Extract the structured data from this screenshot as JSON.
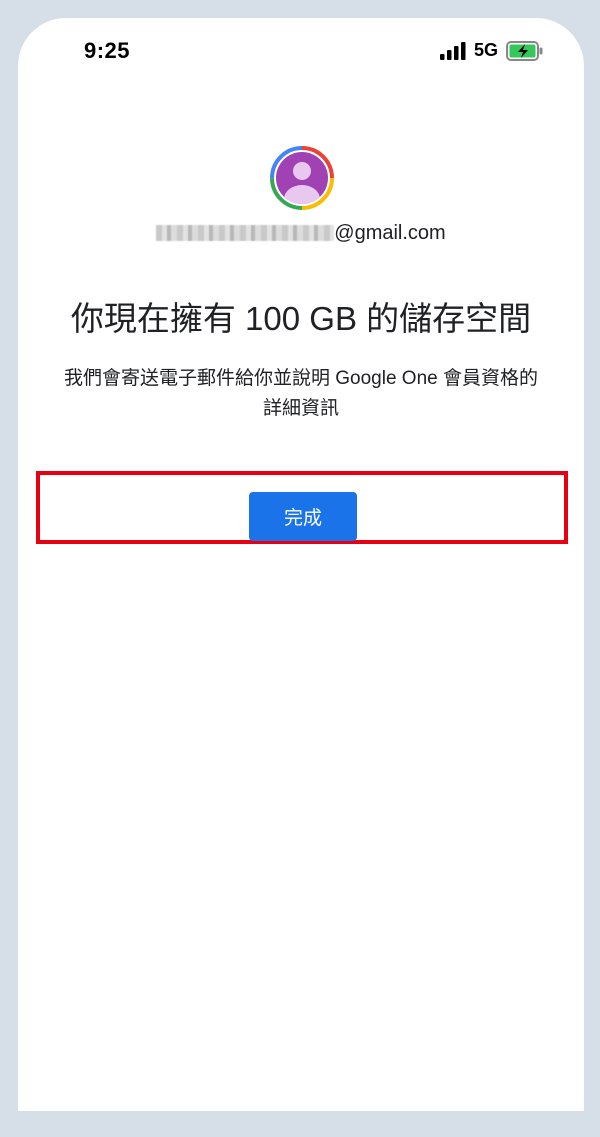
{
  "status_bar": {
    "time": "9:25",
    "network": "5G",
    "signal_icon": "signal-bars-icon",
    "battery_icon": "battery-charging-icon"
  },
  "account": {
    "email_suffix": "@gmail.com",
    "avatar_icon": "account-avatar-icon"
  },
  "main": {
    "title": "你現在擁有 100 GB 的儲存空間",
    "description": "我們會寄送電子郵件給你並說明 Google One 會員資格的詳細資訊",
    "done_button_label": "完成"
  },
  "colors": {
    "primary_button": "#1a73e8",
    "highlight_border": "#e60012",
    "avatar_purple": "#a142b4",
    "battery_green": "#34c759"
  }
}
